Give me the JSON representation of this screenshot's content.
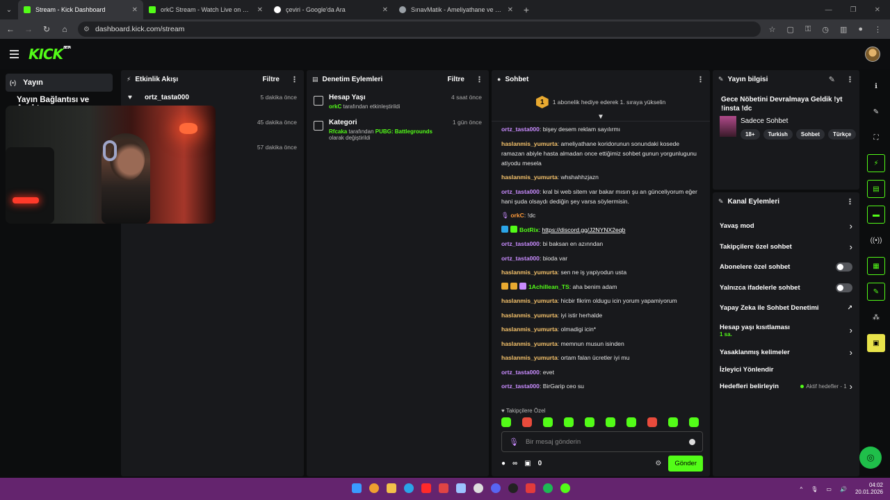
{
  "browser": {
    "tabs": [
      {
        "title": "Stream - Kick Dashboard",
        "color": "#53fc18",
        "active": true
      },
      {
        "title": "orkC Stream - Watch Live on Kick",
        "color": "#53fc18",
        "active": false
      },
      {
        "title": "çeviri - Google'da Ara",
        "color": "#ffffff",
        "active": false
      },
      {
        "title": "SınavMatik - Ameliyathane ve Yoğun Bakım",
        "color": "#9aa0a6",
        "active": false
      }
    ],
    "url": "dashboard.kick.com/stream"
  },
  "header": {
    "logo": "KICK",
    "logo_badge": "BETA"
  },
  "sidebar": {
    "live_label": "Yayın",
    "item": "Yayın Bağlantısı ve Anahtarı"
  },
  "activity": {
    "title": "Etkinlik Akışı",
    "filter": "Filtre",
    "events": [
      {
        "name": "ortz_tasta000",
        "time": "5 dakika önce"
      },
      {
        "name": "",
        "time": "45 dakika önce"
      },
      {
        "name": "",
        "time": "57 dakika önce"
      }
    ]
  },
  "moderation": {
    "title": "Denetim Eylemleri",
    "filter": "Filtre",
    "items": [
      {
        "title": "Hesap Yaşı",
        "actor": "orkC",
        "desc": "tarafından etkinleştirildi",
        "value": "",
        "time": "4 saat önce"
      },
      {
        "title": "Kategori",
        "actor": "Rfcaka",
        "desc": "tarafından",
        "value": "PUBG: Battlegrounds",
        "desc2": "olarak değiştirildi",
        "time": "1 gün önce"
      }
    ]
  },
  "chat": {
    "title": "Sohbet",
    "gift_rank": "1",
    "gift_text": "1 abonelik hediye ederek 1. sıraya yükselin",
    "messages": [
      {
        "user": "ortz_tasta000",
        "color": "p",
        "text": "bişey desem reklam sayılırmı"
      },
      {
        "user": "haslanmis_yumurta",
        "color": "y",
        "text": "ameliyathane koridorunun sonundaki kosede ramazan abiyle hasta almadan once ettiğimiz sohbet gunun yorgunlugunu atiyodu mesela"
      },
      {
        "user": "haslanmis_yumurta",
        "color": "y",
        "text": "whshahhzjazn"
      },
      {
        "user": "ortz_tasta000",
        "color": "p",
        "text": "kral bi web sitem var bakar mısın şu an günceliyorum eğer hani şuda olsaydı dediğin şey varsa söylermisin."
      },
      {
        "user": "orkC",
        "color": "o",
        "text": "!dc"
      },
      {
        "user": "BotRix",
        "color": "g",
        "text": "https://discord.gg/J2NYNX2eqb",
        "link": true
      },
      {
        "user": "ortz_tasta000",
        "color": "p",
        "text": "bi baksan en azınndan"
      },
      {
        "user": "ortz_tasta000",
        "color": "p",
        "text": "bioda var"
      },
      {
        "user": "haslanmis_yumurta",
        "color": "y",
        "text": "sen ne iş yapiyodun usta"
      },
      {
        "user": "1Achillean_TS",
        "color": "g",
        "text": "aha benim adam"
      },
      {
        "user": "haslanmis_yumurta",
        "color": "y",
        "text": "hicbir fikrim oldugu icin yorum yapamiyorum"
      },
      {
        "user": "haslanmis_yumurta",
        "color": "y",
        "text": "iyi istir herhalde"
      },
      {
        "user": "haslanmis_yumurta",
        "color": "y",
        "text": "olmadigi icin*"
      },
      {
        "user": "haslanmis_yumurta",
        "color": "y",
        "text": "memnun musun isinden"
      },
      {
        "user": "haslanmis_yumurta",
        "color": "y",
        "text": "ortam falan ücretler iyi mu"
      },
      {
        "user": "ortz_tasta000",
        "color": "p",
        "text": "evet"
      },
      {
        "user": "ortz_tasta000",
        "color": "p",
        "text": "BirGarip ceo su"
      }
    ],
    "followers_only": "Takipçilere Özel",
    "input_placeholder": "Bir mesaj gönderin",
    "points": "∞",
    "store_count": "0",
    "send_label": "Gönder"
  },
  "stream_info": {
    "title": "Yayın bilgisi",
    "stream_title": "Gece Nöbetini Devralmaya Geldik !yt !insta !dc",
    "category": "Sadece Sohbet",
    "tags": [
      "18+",
      "Turkish",
      "Sohbet",
      "Türkçe"
    ]
  },
  "channel_actions": {
    "title": "Kanal Eylemleri",
    "slow_mode": "Yavaş mod",
    "followers_chat": "Takipçilere özel sohbet",
    "subscribers_chat": "Abonelere özel sohbet",
    "emotes_chat": "Yalnızca ifadelerle sohbet",
    "ai_mod": "Yapay Zeka ile Sohbet Denetimi",
    "account_age": "Hesap yaşı kısıtlaması",
    "account_age_value": "1 sa.",
    "banned_words": "Yasaklanmış kelimeler",
    "raid": "İzleyici Yönlendir",
    "goals": "Hedefleri belirleyin",
    "goals_status": "Aktif hedefler - 1"
  },
  "taskbar": {
    "time": "04:02",
    "date": "20.01.2026"
  },
  "colors": {
    "accent": "#53fc18",
    "panel": "#18191c",
    "taskbar": "#64246e"
  }
}
